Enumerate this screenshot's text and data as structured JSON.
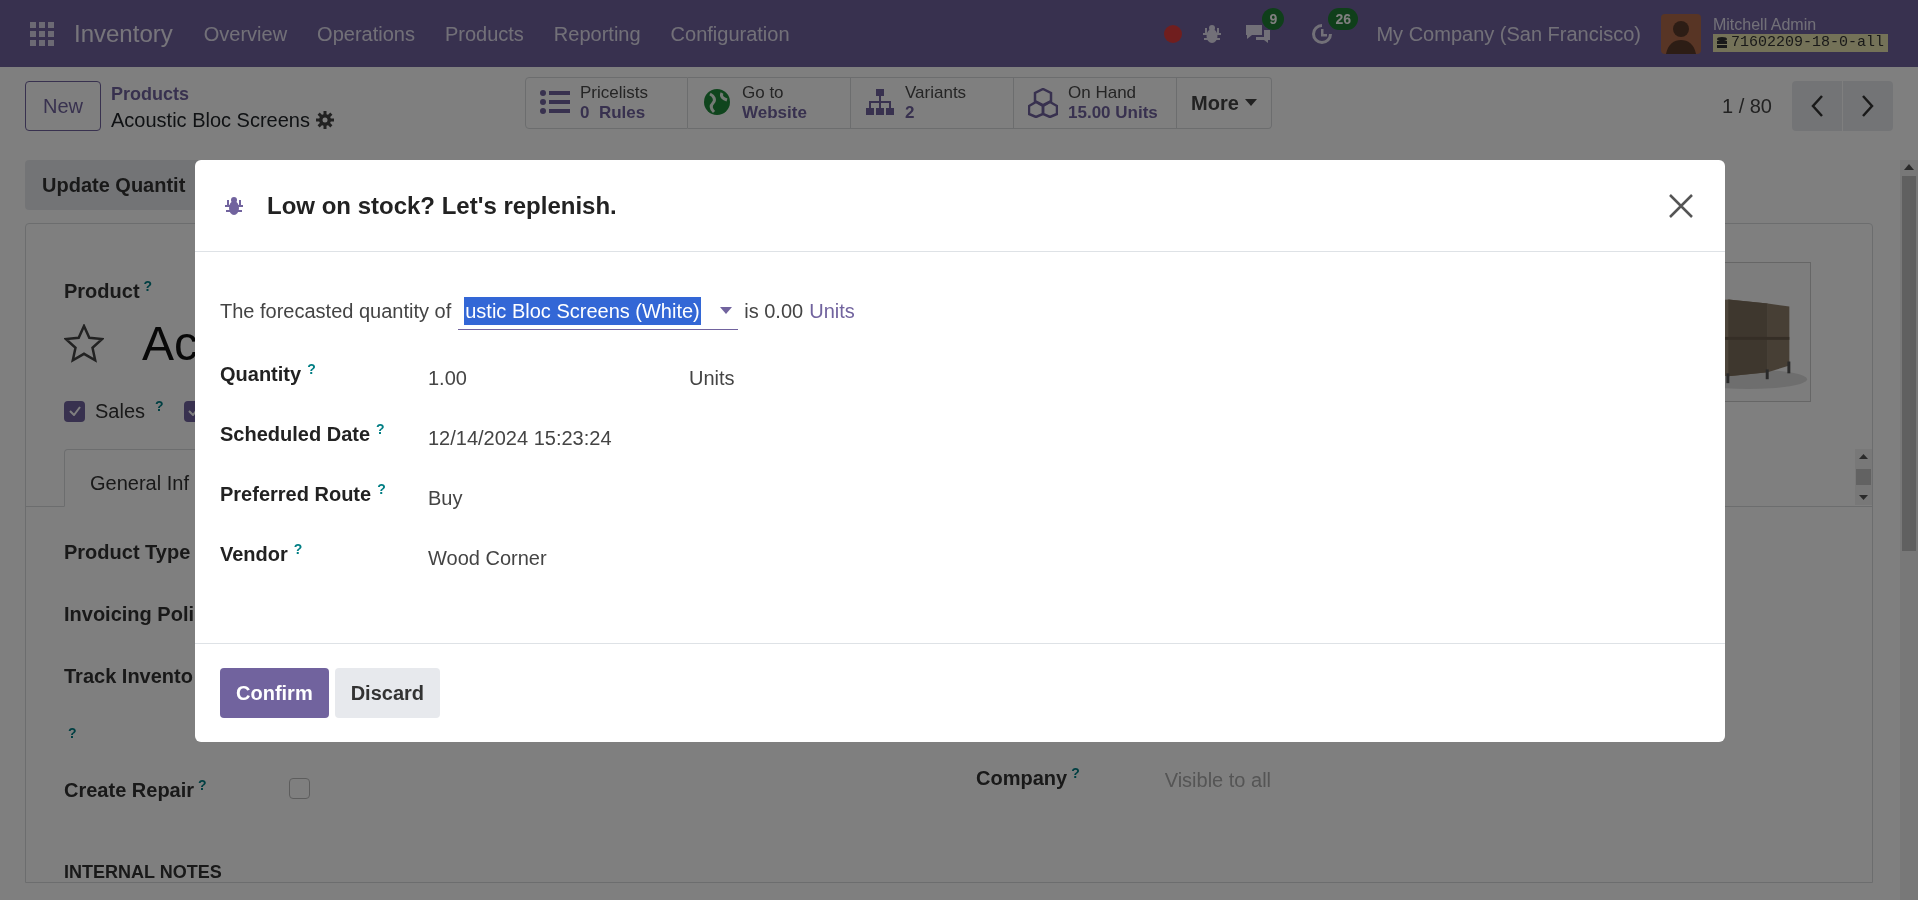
{
  "navbar": {
    "app_name": "Inventory",
    "menu": [
      "Overview",
      "Operations",
      "Products",
      "Reporting",
      "Configuration"
    ],
    "counters": [
      {
        "kind": "messages",
        "count": "9"
      },
      {
        "kind": "activities",
        "count": "26"
      }
    ],
    "company": "My Company (San Francisco)",
    "user": "Mitchell Admin",
    "database": "71602209-18-0-all"
  },
  "control_panel": {
    "new_button": "New",
    "breadcrumb": "Products",
    "record_title": "Acoustic Bloc Screens",
    "smart_buttons": [
      {
        "kind": "list",
        "label": "Pricelists",
        "value": "0  Rules"
      },
      {
        "kind": "globe",
        "label": "Go to",
        "value": "Website"
      },
      {
        "kind": "hierarchy",
        "label": "Variants",
        "value": "2"
      },
      {
        "kind": "cubes",
        "label": "On Hand",
        "value": "15.00 Units"
      }
    ],
    "more_button": "More",
    "pager": "1 / 80"
  },
  "form": {
    "update_button": "Update Quantit",
    "product_label": "Product",
    "product_help": "?",
    "product_name": "Ac",
    "favorite": false,
    "options": [
      {
        "label": "Sales",
        "help": "?",
        "checked": true
      },
      {
        "checked": true
      }
    ],
    "tabs": [
      {
        "label": "General Inf",
        "selected": true
      }
    ],
    "fields": [
      {
        "label": "Product Type"
      },
      {
        "label": "Invoicing Poli"
      },
      {
        "label": "Track Invento"
      },
      {
        "help": "?"
      }
    ],
    "create_repair": {
      "label": "Create Repair",
      "help": "?",
      "checked": false
    },
    "company": {
      "label": "Company",
      "help": "?",
      "placeholder": "Visible to all"
    },
    "section": "INTERNAL NOTES"
  },
  "dialog": {
    "title": "Low on stock? Let's replenish.",
    "forecast": {
      "before": "The forecasted quantity of",
      "product": "ustic Bloc Screens (White)",
      "after": "is 0.00",
      "unit": "Units"
    },
    "fields": [
      {
        "label": "Quantity",
        "help": "?",
        "value": "1.00",
        "unit": "Units"
      },
      {
        "label": "Scheduled Date",
        "help": "?",
        "value": "12/14/2024 15:23:24"
      },
      {
        "label": "Preferred Route",
        "help": "?",
        "value": "Buy"
      },
      {
        "label": "Vendor",
        "help": "?",
        "value": "Wood Corner"
      }
    ],
    "buttons": [
      {
        "label": "Confirm",
        "kind": "primary"
      },
      {
        "label": "Discard",
        "kind": "secondary"
      }
    ]
  }
}
